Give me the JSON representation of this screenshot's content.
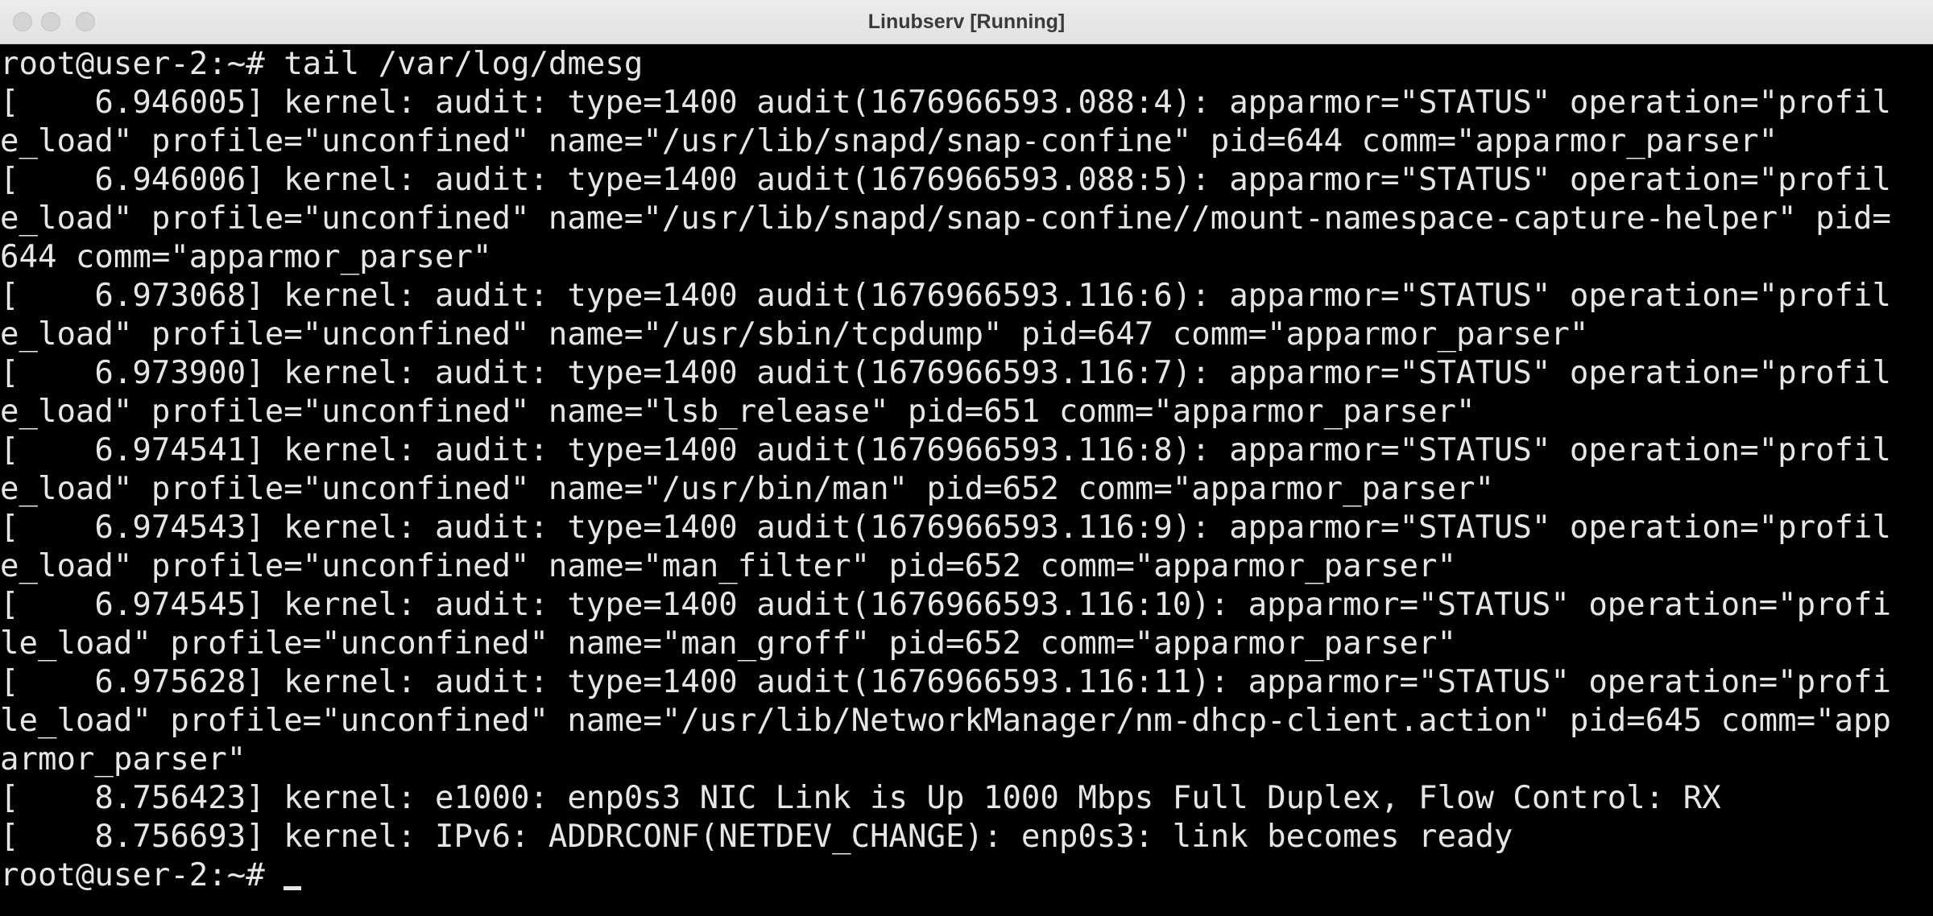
{
  "window": {
    "title": "Linubserv [Running]"
  },
  "terminal": {
    "lines": [
      "root@user-2:~# tail /var/log/dmesg",
      "[    6.946005] kernel: audit: type=1400 audit(1676966593.088:4): apparmor=\"STATUS\" operation=\"profil",
      "e_load\" profile=\"unconfined\" name=\"/usr/lib/snapd/snap-confine\" pid=644 comm=\"apparmor_parser\"",
      "[    6.946006] kernel: audit: type=1400 audit(1676966593.088:5): apparmor=\"STATUS\" operation=\"profil",
      "e_load\" profile=\"unconfined\" name=\"/usr/lib/snapd/snap-confine//mount-namespace-capture-helper\" pid=",
      "644 comm=\"apparmor_parser\"",
      "[    6.973068] kernel: audit: type=1400 audit(1676966593.116:6): apparmor=\"STATUS\" operation=\"profil",
      "e_load\" profile=\"unconfined\" name=\"/usr/sbin/tcpdump\" pid=647 comm=\"apparmor_parser\"",
      "[    6.973900] kernel: audit: type=1400 audit(1676966593.116:7): apparmor=\"STATUS\" operation=\"profil",
      "e_load\" profile=\"unconfined\" name=\"lsb_release\" pid=651 comm=\"apparmor_parser\"",
      "[    6.974541] kernel: audit: type=1400 audit(1676966593.116:8): apparmor=\"STATUS\" operation=\"profil",
      "e_load\" profile=\"unconfined\" name=\"/usr/bin/man\" pid=652 comm=\"apparmor_parser\"",
      "[    6.974543] kernel: audit: type=1400 audit(1676966593.116:9): apparmor=\"STATUS\" operation=\"profil",
      "e_load\" profile=\"unconfined\" name=\"man_filter\" pid=652 comm=\"apparmor_parser\"",
      "[    6.974545] kernel: audit: type=1400 audit(1676966593.116:10): apparmor=\"STATUS\" operation=\"profi",
      "le_load\" profile=\"unconfined\" name=\"man_groff\" pid=652 comm=\"apparmor_parser\"",
      "[    6.975628] kernel: audit: type=1400 audit(1676966593.116:11): apparmor=\"STATUS\" operation=\"profi",
      "le_load\" profile=\"unconfined\" name=\"/usr/lib/NetworkManager/nm-dhcp-client.action\" pid=645 comm=\"app",
      "armor_parser\"",
      "[    8.756423] kernel: e1000: enp0s3 NIC Link is Up 1000 Mbps Full Duplex, Flow Control: RX",
      "[    8.756693] kernel: IPv6: ADDRCONF(NETDEV_CHANGE): enp0s3: link becomes ready"
    ],
    "prompt": "root@user-2:~# "
  }
}
